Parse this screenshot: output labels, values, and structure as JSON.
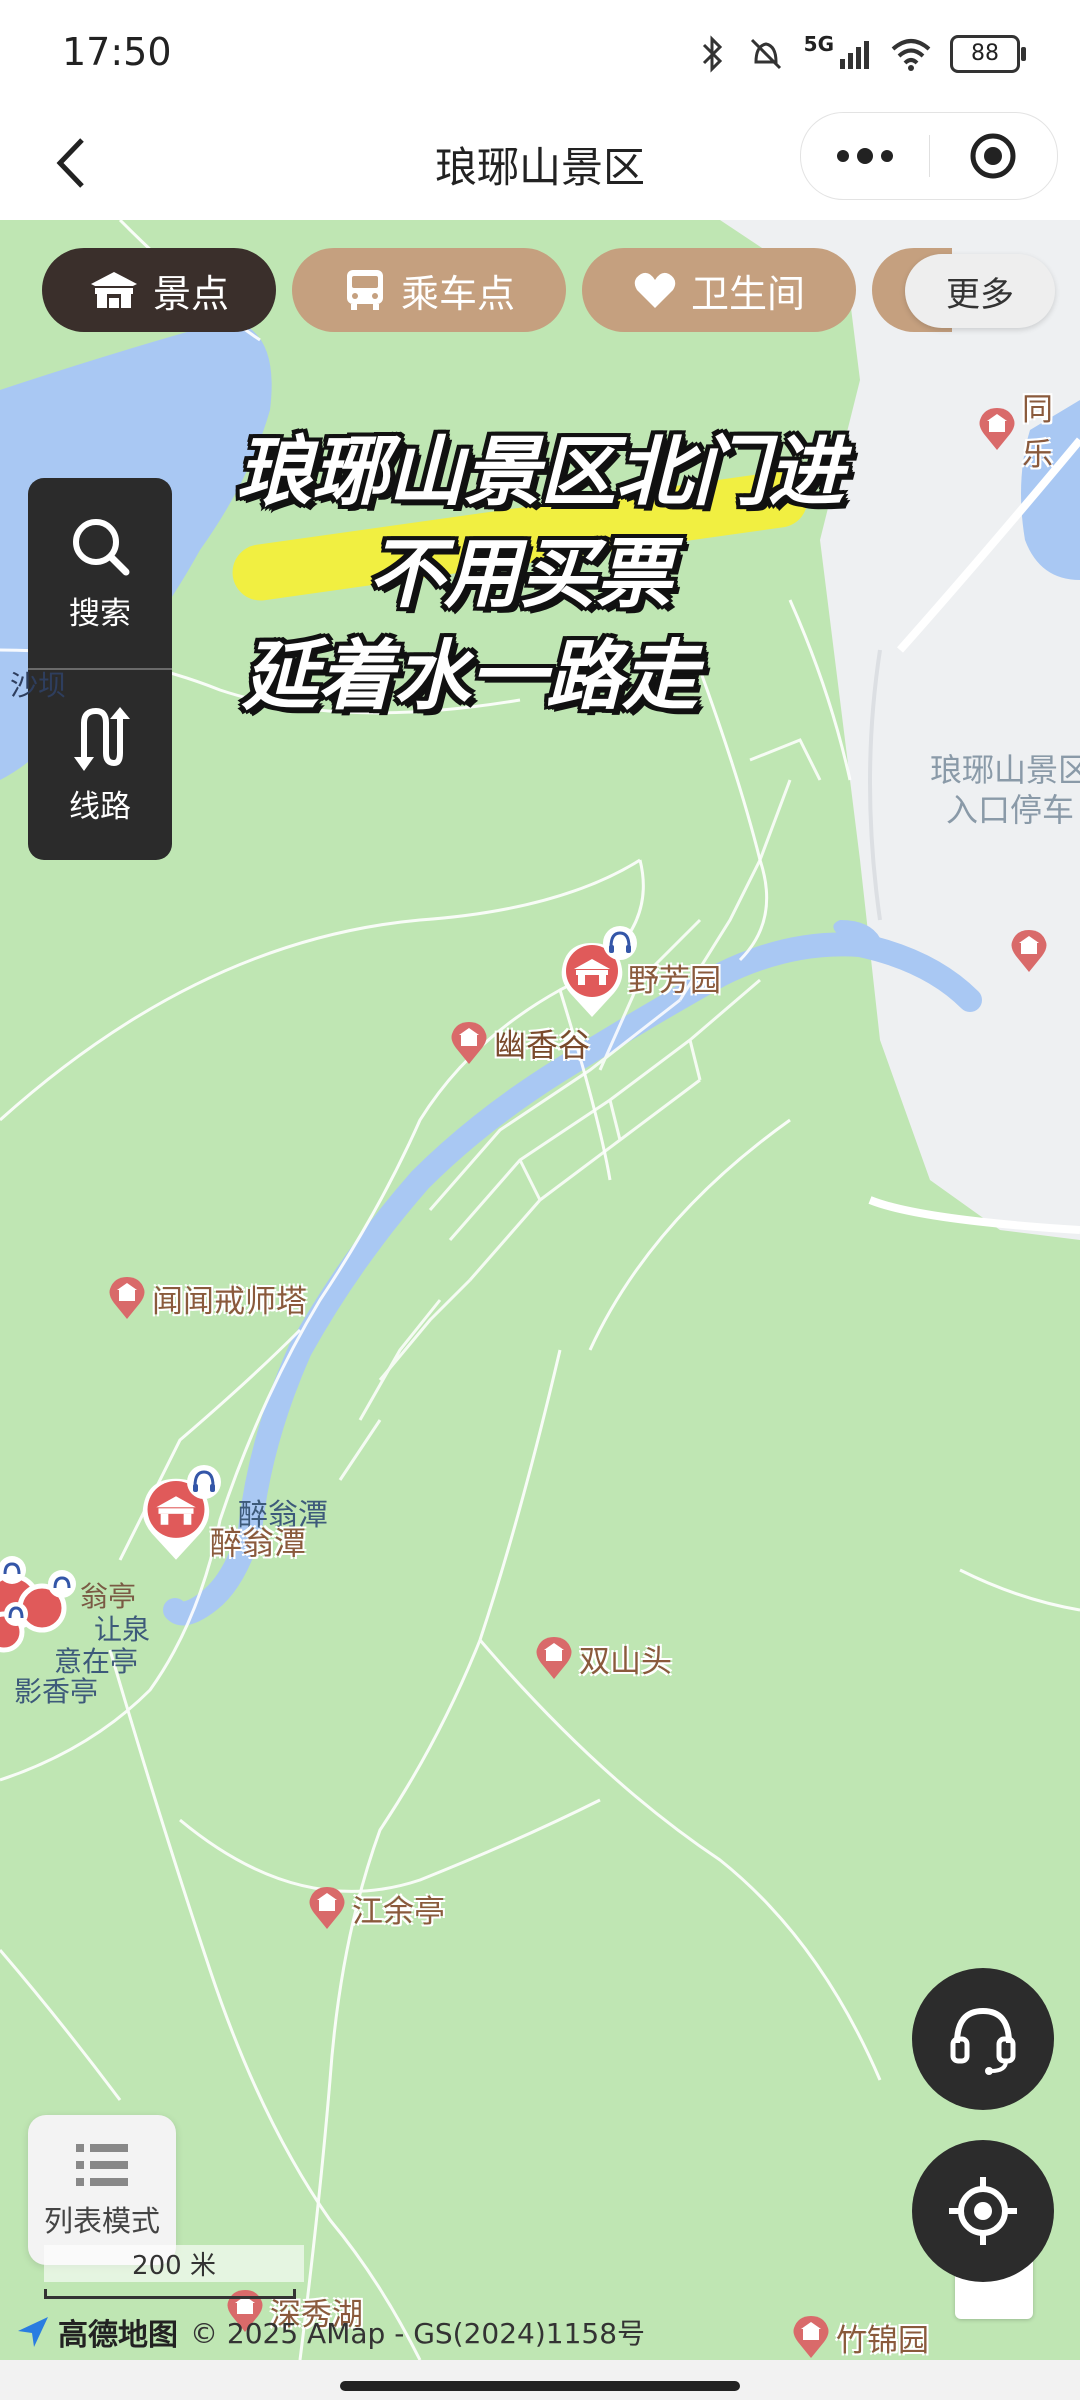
{
  "status_bar": {
    "time": "17:50",
    "network": "5G",
    "battery": "88"
  },
  "nav": {
    "title": "琅琊山景区"
  },
  "tabs": [
    {
      "label": "景点",
      "icon": "scenic-spot-icon",
      "active": true
    },
    {
      "label": "乘车点",
      "icon": "bus-icon",
      "active": false
    },
    {
      "label": "卫生间",
      "icon": "heart-icon",
      "active": false
    }
  ],
  "tab_more": "更多",
  "tools": {
    "search": "搜索",
    "route": "线路"
  },
  "caption": {
    "line1": "琅琊山景区北门进",
    "line2": "不用买票",
    "line3": "延着水一路走"
  },
  "pois": {
    "tongle": "同乐",
    "yexiangyuan": "野芳园",
    "youxianggu": "幽香谷",
    "wenwenta": "闻闻戒师塔",
    "zuiwengtan_small": "醉翁潭",
    "zuiwengtan_big": "醉翁潭",
    "shuangshantou": "双山头",
    "jiangyuting": "江余亭",
    "shenxiuhu": "深秀湖",
    "zhujinyuan": "竹锦园",
    "entrance_parking": "琅琊山景区\n入口停车",
    "shaba": "沙坝",
    "cluster_1": "翁亭",
    "cluster_2": "让泉",
    "cluster_3": "意在亭",
    "cluster_4": "影香亭"
  },
  "list_mode": "列表模式",
  "scale": "200 米",
  "attribution": {
    "logo": "高德地图",
    "copyright": "© 2025 AMap - GS(2024)1158号"
  },
  "colors": {
    "map_green": "#bfe6b3",
    "water": "#a9c8f3",
    "tab_active": "#3a2f2b",
    "tab_inactive": "#c5a07f",
    "poi_pin": "#d96a6a"
  }
}
